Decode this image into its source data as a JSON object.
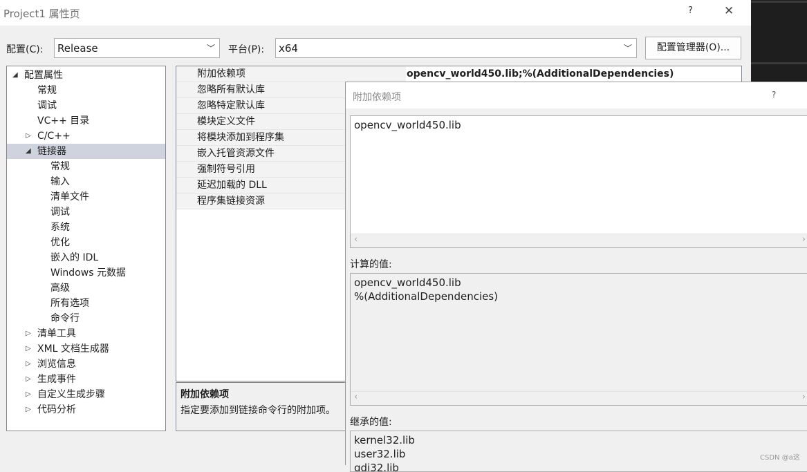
{
  "window": {
    "title": "Project1 属性页",
    "help": "?",
    "close": "✕"
  },
  "toolbar": {
    "config_label": "配置(C):",
    "config_value": "Release",
    "platform_label": "平台(P):",
    "platform_value": "x64",
    "config_manager_button": "配置管理器(O)..."
  },
  "tree": {
    "items": [
      {
        "label": "配置属性",
        "toggle": "◢",
        "level": 0
      },
      {
        "label": "常规",
        "level": 1
      },
      {
        "label": "调试",
        "level": 1
      },
      {
        "label": "VC++ 目录",
        "level": 1
      },
      {
        "label": "C/C++",
        "toggle": "▷",
        "level": 1
      },
      {
        "label": "链接器",
        "toggle": "◢",
        "level": 1
      },
      {
        "label": "常规",
        "level": 2
      },
      {
        "label": "输入",
        "level": 2
      },
      {
        "label": "清单文件",
        "level": 2
      },
      {
        "label": "调试",
        "level": 2
      },
      {
        "label": "系统",
        "level": 2
      },
      {
        "label": "优化",
        "level": 2
      },
      {
        "label": "嵌入的 IDL",
        "level": 2
      },
      {
        "label": "Windows 元数据",
        "level": 2
      },
      {
        "label": "高级",
        "level": 2
      },
      {
        "label": "所有选项",
        "level": 2
      },
      {
        "label": "命令行",
        "level": 2
      },
      {
        "label": "清单工具",
        "toggle": "▷",
        "level": 1
      },
      {
        "label": "XML 文档生成器",
        "toggle": "▷",
        "level": 1
      },
      {
        "label": "浏览信息",
        "toggle": "▷",
        "level": 1
      },
      {
        "label": "生成事件",
        "toggle": "▷",
        "level": 1
      },
      {
        "label": "自定义生成步骤",
        "toggle": "▷",
        "level": 1
      },
      {
        "label": "代码分析",
        "toggle": "▷",
        "level": 1
      }
    ]
  },
  "grid": {
    "rows": [
      {
        "name": "附加依赖项",
        "value": "opencv_world450.lib;%(AdditionalDependencies)"
      },
      {
        "name": "忽略所有默认库",
        "value": ""
      },
      {
        "name": "忽略特定默认库",
        "value": ""
      },
      {
        "name": "模块定义文件",
        "value": ""
      },
      {
        "name": "将模块添加到程序集",
        "value": ""
      },
      {
        "name": "嵌入托管资源文件",
        "value": ""
      },
      {
        "name": "强制符号引用",
        "value": ""
      },
      {
        "name": "延迟加载的 DLL",
        "value": ""
      },
      {
        "name": "程序集链接资源",
        "value": ""
      }
    ]
  },
  "description": {
    "title": "附加依赖项",
    "text": "指定要添加到链接命令行的附加项。"
  },
  "dialog": {
    "title": "附加依赖项",
    "help": "?",
    "edit_lines": [
      "opencv_world450.lib"
    ],
    "computed_label": "计算的值:",
    "computed_lines": [
      "opencv_world450.lib",
      "%(AdditionalDependencies)"
    ],
    "inherited_label": "继承的值:",
    "inherited_lines": [
      "kernel32.lib",
      "user32.lib",
      "gdi32.lib"
    ]
  },
  "watermark": "CSDN @a这"
}
